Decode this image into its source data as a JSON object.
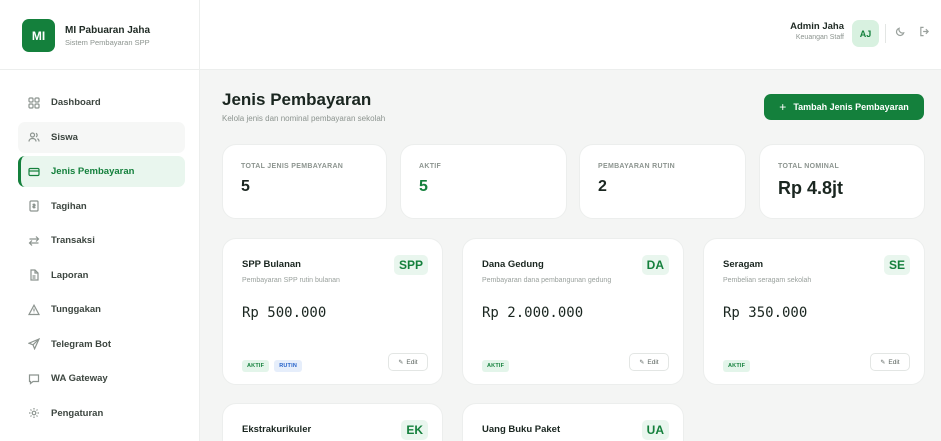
{
  "brand": {
    "logo": "MI",
    "name": "MI Pabuaran Jaha",
    "subtitle": "Sistem Pembayaran SPP"
  },
  "sidebar": {
    "items": [
      {
        "label": "Dashboard",
        "icon": "grid-icon"
      },
      {
        "label": "Siswa",
        "icon": "users-icon"
      },
      {
        "label": "Jenis Pembayaran",
        "icon": "card-icon",
        "active": true
      },
      {
        "label": "Tagihan",
        "icon": "receipt-icon"
      },
      {
        "label": "Transaksi",
        "icon": "swap-icon"
      },
      {
        "label": "Laporan",
        "icon": "file-icon"
      },
      {
        "label": "Tunggakan",
        "icon": "warning-icon"
      },
      {
        "label": "Telegram Bot",
        "icon": "send-icon"
      },
      {
        "label": "WA Gateway",
        "icon": "chat-icon"
      },
      {
        "label": "Pengaturan",
        "icon": "gear-icon"
      }
    ]
  },
  "topbar": {
    "user_name": "Admin Jaha",
    "user_role": "Keuangan Staff",
    "avatar": "AJ"
  },
  "page": {
    "title": "Jenis Pembayaran",
    "subtitle": "Kelola jenis dan nominal pembayaran sekolah",
    "add_button": "Tambah Jenis Pembayaran"
  },
  "stats": [
    {
      "label": "TOTAL JENIS PEMBAYARAN",
      "value": "5"
    },
    {
      "label": "AKTIF",
      "value": "5"
    },
    {
      "label": "PEMBAYARAN RUTIN",
      "value": "2"
    },
    {
      "label": "TOTAL NOMINAL",
      "value": "Rp 4.8jt"
    }
  ],
  "cards": [
    {
      "name": "SPP Bulanan",
      "code": "SPP",
      "desc": "Pembayaran SPP rutin bulanan",
      "amount": "Rp 500.000",
      "badges": [
        "AKTIF",
        "RUTIN"
      ],
      "edit": "Edit"
    },
    {
      "name": "Dana Gedung",
      "code": "DA",
      "desc": "Pembayaran dana pembangunan gedung",
      "amount": "Rp 2.000.000",
      "badges": [
        "AKTIF"
      ],
      "edit": "Edit"
    },
    {
      "name": "Seragam",
      "code": "SE",
      "desc": "Pembelian seragam sekolah",
      "amount": "Rp 350.000",
      "badges": [
        "AKTIF"
      ],
      "edit": "Edit"
    },
    {
      "name": "Ekstrakurikuler",
      "code": "EK"
    },
    {
      "name": "Uang Buku Paket",
      "code": "UA"
    }
  ],
  "colors": {
    "accent": "#14803c",
    "accent_light": "#e9f6ee",
    "info": "#2360c9"
  }
}
